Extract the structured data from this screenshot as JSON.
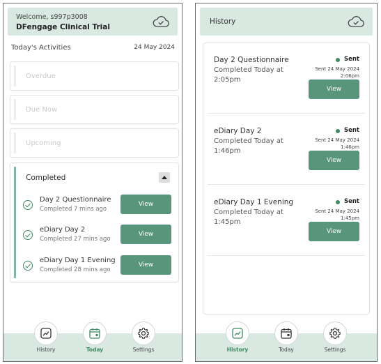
{
  "left": {
    "header": {
      "welcome": "Welcome, s997p3008",
      "trial": "DFengage Clinical Trial"
    },
    "section_title": "Today's Activities",
    "date": "24 May 2024",
    "categories": [
      "Overdue",
      "Due Now",
      "Upcoming"
    ],
    "completed": {
      "title": "Completed",
      "items": [
        {
          "name": "Day 2 Questionnaire",
          "sub": "Completed 7 mins ago",
          "button": "View"
        },
        {
          "name": "eDiary Day 2",
          "sub": "Completed 27 mins ago",
          "button": "View"
        },
        {
          "name": "eDiary Day 1 Evening",
          "sub": "Completed 28 mins ago",
          "button": "View"
        }
      ]
    }
  },
  "right": {
    "header": {
      "title": "History"
    },
    "items": [
      {
        "name": "Day 2 Questionnaire",
        "completed": "Completed Today at 2:05pm",
        "status": "Sent",
        "sent_date": "Sent 24 May 2024",
        "sent_time": "2:06pm",
        "button": "View"
      },
      {
        "name": "eDiary Day 2",
        "completed": "Completed Today at 1:46pm",
        "status": "Sent",
        "sent_date": "Sent 24 May 2024",
        "sent_time": "1:46pm",
        "button": "View"
      },
      {
        "name": "eDiary Day 1 Evening",
        "completed": "Completed Today at 1:45pm",
        "status": "Sent",
        "sent_date": "Sent 24 May 2024",
        "sent_time": "1:45pm",
        "button": "View"
      }
    ]
  },
  "nav": {
    "history": "History",
    "today": "Today",
    "settings": "Settings"
  },
  "icons": {
    "sync": "cloud-check-icon",
    "history": "chart-line-icon",
    "today": "calendar-icon",
    "settings": "gear-icon"
  },
  "colors": {
    "accent": "#58957a",
    "header_bg": "#d9e9e2",
    "check": "#3f8a62"
  }
}
